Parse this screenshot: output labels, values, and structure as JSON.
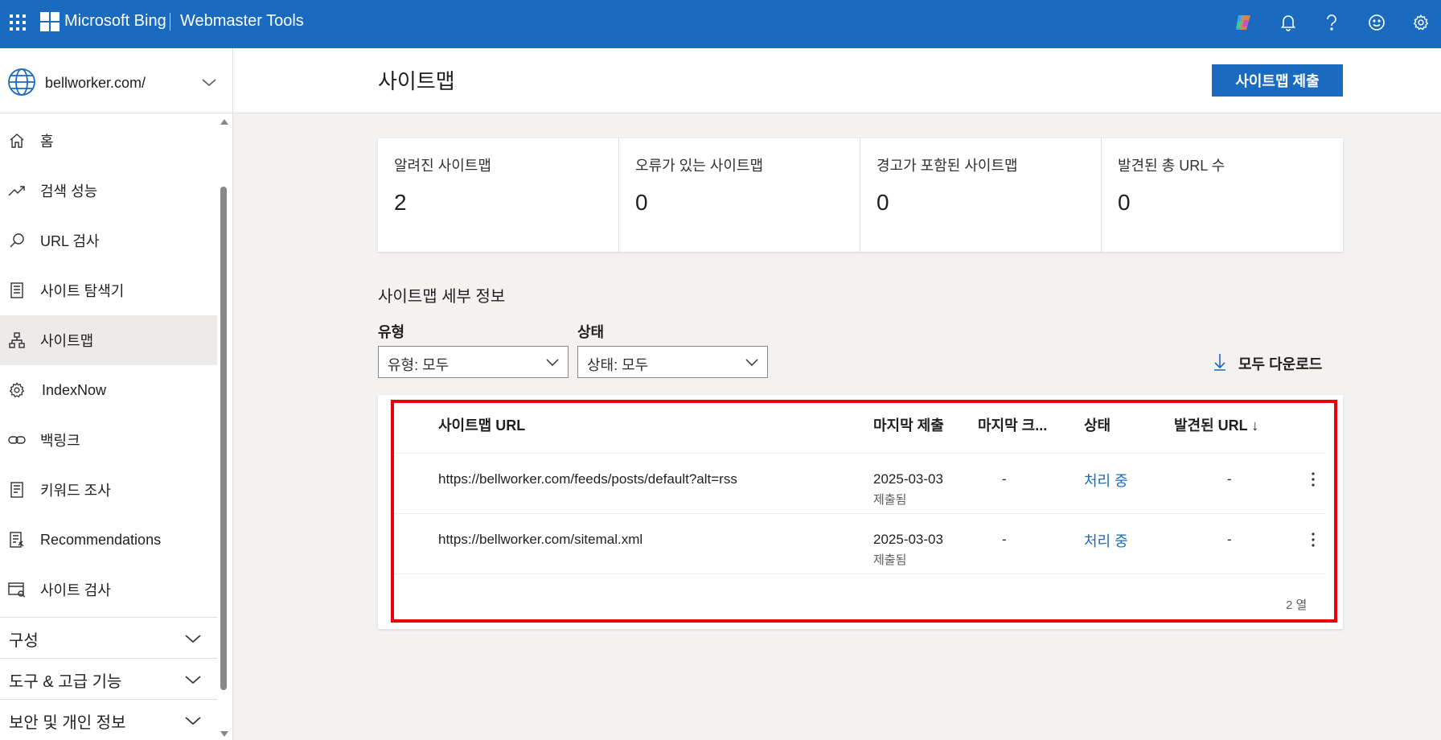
{
  "header": {
    "brand": "Microsoft Bing",
    "product": "Webmaster Tools",
    "icons": [
      "waffle-icon",
      "copilot-icon",
      "bell-icon",
      "help-icon",
      "smiley-icon",
      "gear-icon"
    ]
  },
  "sidebar": {
    "site": "bellworker.com/",
    "items": [
      {
        "label": "홈",
        "icon": "home-icon"
      },
      {
        "label": "검색 성능",
        "icon": "trend-icon"
      },
      {
        "label": "URL 검사",
        "icon": "search-icon"
      },
      {
        "label": "사이트 탐색기",
        "icon": "document-icon"
      },
      {
        "label": "사이트맵",
        "icon": "sitemap-icon",
        "active": true
      },
      {
        "label": "IndexNow",
        "icon": "gear-icon"
      },
      {
        "label": "백링크",
        "icon": "link-icon"
      },
      {
        "label": "키워드 조사",
        "icon": "document-icon"
      },
      {
        "label": "Recommendations",
        "icon": "clipboard-icon"
      },
      {
        "label": "사이트 검사",
        "icon": "scan-icon"
      }
    ],
    "groups": [
      "구성",
      "도구 & 고급 기능",
      "보안 및 개인 정보"
    ]
  },
  "page": {
    "title": "사이트맵",
    "submit_button": "사이트맵 제출"
  },
  "summary": [
    {
      "label": "알려진 사이트맵",
      "value": "2"
    },
    {
      "label": "오류가 있는 사이트맵",
      "value": "0"
    },
    {
      "label": "경고가 포함된 사이트맵",
      "value": "0"
    },
    {
      "label": "발견된 총 URL 수",
      "value": "0"
    }
  ],
  "details": {
    "title": "사이트맵 세부 정보",
    "type_filter": {
      "label": "유형",
      "value": "유형: 모두"
    },
    "status_filter": {
      "label": "상태",
      "value": "상태: 모두"
    },
    "download_all": "모두 다운로드"
  },
  "table": {
    "columns": [
      "사이트맵 URL",
      "마지막 제출",
      "마지막 크...",
      "상태",
      "발견된 URL ↓"
    ],
    "rows": [
      {
        "url": "https://bellworker.com/feeds/posts/default?alt=rss",
        "last_submitted": "2025-03-03",
        "submitted_note": "제출됨",
        "last_crawled": "-",
        "status": "처리 중",
        "discovered": "-"
      },
      {
        "url": "https://bellworker.com/sitemal.xml",
        "last_submitted": "2025-03-03",
        "submitted_note": "제출됨",
        "last_crawled": "-",
        "status": "처리 중",
        "discovered": "-"
      }
    ],
    "row_count": "2 열"
  },
  "colors": {
    "brand_blue": "#1a6abf",
    "highlight_red": "#e8000b"
  }
}
